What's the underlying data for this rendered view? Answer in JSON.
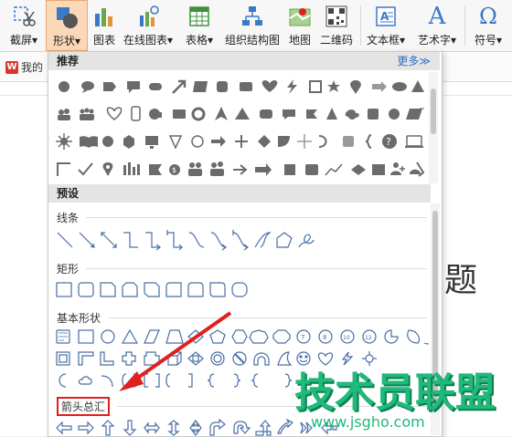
{
  "ribbon": {
    "buttons": [
      {
        "label": "截屏▾",
        "icon": "scissors-icon"
      },
      {
        "label": "形状▾",
        "icon": "shapes-icon"
      },
      {
        "label": "图表",
        "icon": "chart-icon"
      },
      {
        "label": "在线图表▾",
        "icon": "online-chart-icon"
      },
      {
        "label": "表格▾",
        "icon": "table-icon"
      },
      {
        "label": "组织结构图",
        "icon": "org-chart-icon"
      },
      {
        "label": "地图",
        "icon": "map-icon"
      },
      {
        "label": "二维码",
        "icon": "qrcode-icon"
      },
      {
        "label": "文本框▾",
        "icon": "textbox-icon"
      },
      {
        "label": "艺术字▾",
        "icon": "wordart-icon"
      },
      {
        "label": "符号▾",
        "icon": "symbol-icon"
      }
    ],
    "wordart_glyph": "A",
    "symbol_glyph": "Ω"
  },
  "document": {
    "tab_label": "我的",
    "logo_letter": "W",
    "title_char": "题"
  },
  "panel": {
    "recommended": {
      "title": "推荐",
      "more": "更多≫"
    },
    "presets": {
      "title": "预设"
    },
    "categories": {
      "lines": "线条",
      "rectangles": "矩形",
      "basic_shapes": "基本形状",
      "arrows": "箭头总汇"
    },
    "basic_glyphs": {
      "n7": "7",
      "n8": "8",
      "n10": "10",
      "n12": "12"
    }
  },
  "watermark": {
    "main": "技术员联盟",
    "url": "www.jsgho.com"
  },
  "colors": {
    "accent": "#fbd9b8",
    "highlight_red": "#e0201e",
    "watermark_green": "#1fb97a",
    "shape_gray": "#6b6b6b",
    "preset_blue": "#4a6fa5"
  }
}
